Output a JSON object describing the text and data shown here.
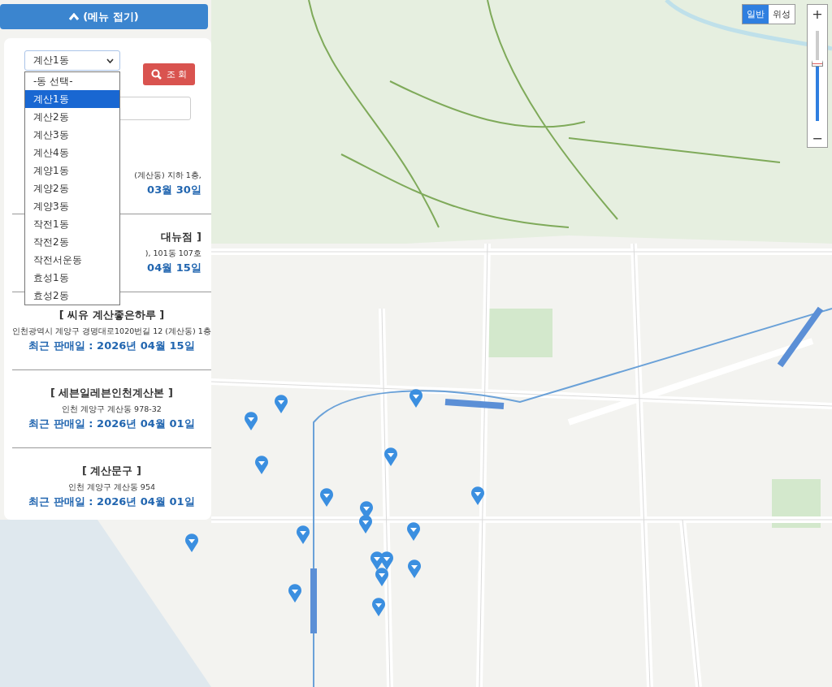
{
  "menu_toggle": {
    "label": "(메뉴 접기)"
  },
  "district_select": {
    "value": "계산1동",
    "expanded": true,
    "options": [
      {
        "label": "-동 선택-",
        "selected": false
      },
      {
        "label": "계산1동",
        "selected": true
      },
      {
        "label": "계산2동",
        "selected": false
      },
      {
        "label": "계산3동",
        "selected": false
      },
      {
        "label": "계산4동",
        "selected": false
      },
      {
        "label": "계양1동",
        "selected": false
      },
      {
        "label": "계양2동",
        "selected": false
      },
      {
        "label": "계양3동",
        "selected": false
      },
      {
        "label": "작전1동",
        "selected": false
      },
      {
        "label": "작전2동",
        "selected": false
      },
      {
        "label": "작전서운동",
        "selected": false
      },
      {
        "label": "효성1동",
        "selected": false
      },
      {
        "label": "효성2동",
        "selected": false
      }
    ]
  },
  "search_button": {
    "label": "조 회"
  },
  "stores": [
    {
      "kind": "partial",
      "address": "(계산동) 지하 1층,",
      "last_sale": "03월 30일"
    },
    {
      "kind": "partial",
      "name": "대뉴점 ]",
      "address": "), 101동 107호",
      "last_sale": "04월 15일"
    },
    {
      "kind": "full",
      "name": "[ 씨유 계산좋은하루 ]",
      "address": "인천광역시 계양구 경명대로1020번길 12 (계산동) 1층",
      "last_sale": "최근 판매일 : 2026년 04월 15일"
    },
    {
      "kind": "full",
      "name": "[ 세븐일레븐인천계산본 ]",
      "address": "인천 계양구 계산동 978-32",
      "last_sale": "최근 판매일 : 2026년 04월 01일"
    },
    {
      "kind": "full",
      "name": "[ 계산문구 ]",
      "address": "인천 계양구 계산동 954",
      "last_sale": "최근 판매일 : 2026년 04월 01일"
    }
  ],
  "map_type_tabs": [
    {
      "label": "일반",
      "selected": true
    },
    {
      "label": "위성",
      "selected": false
    }
  ],
  "zoom_control": {
    "zoom_in": "+",
    "zoom_out": "−",
    "level": 0.65
  }
}
